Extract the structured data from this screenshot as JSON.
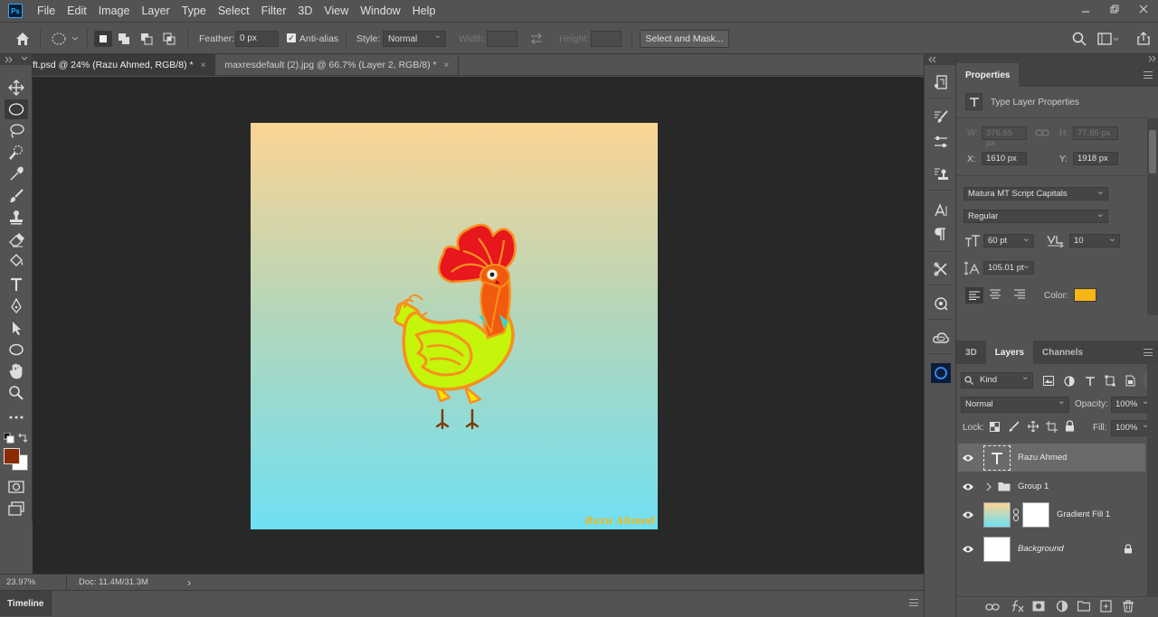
{
  "app": {
    "logo": "Ps",
    "menu": [
      "File",
      "Edit",
      "Image",
      "Layer",
      "Type",
      "Select",
      "Filter",
      "3D",
      "View",
      "Window",
      "Help"
    ]
  },
  "options": {
    "feather_label": "Feather:",
    "feather_value": "0 px",
    "antialias_label": "Anti-alias",
    "style_label": "Style:",
    "style_value": "Normal",
    "width_label": "Width:",
    "height_label": "Height:",
    "select_mask_label": "Select and Mask..."
  },
  "tabs": [
    {
      "label": "ft.psd @ 24% (Razu Ahmed, RGB/8) *",
      "close": "×"
    },
    {
      "label": "maxresdefault (2).jpg @ 66.7% (Layer 2, RGB/8) *",
      "close": "×"
    }
  ],
  "canvas": {
    "signature": "Razu Ahmed",
    "colors": {
      "gradient_top": "#fcd494",
      "gradient_bottom": "#6fe0f2",
      "body": "#c4f50a",
      "outline": "#f7901e",
      "comb": "#e8161d"
    }
  },
  "status": {
    "zoom": "23.97%",
    "doc": "Doc: 11.4M/31.3M",
    "arrow": "›"
  },
  "timeline": {
    "label": "Timeline"
  },
  "properties": {
    "tab": "Properties",
    "title": "Type Layer Properties",
    "w_label": "W:",
    "w_value": "376.55 px",
    "h_label": "H:",
    "h_value": "77.65 px",
    "x_label": "X:",
    "x_value": "1610 px",
    "y_label": "Y:",
    "y_value": "1918 px",
    "font_family": "Matura MT Script Capitals",
    "font_style": "Regular",
    "font_size": "60 pt",
    "tracking": "10",
    "leading": "105.01 pt",
    "color_label": "Color:",
    "text_color": "#f7b516"
  },
  "layers_panel": {
    "tabs": [
      "3D",
      "Layers",
      "Channels"
    ],
    "kind": "Kind",
    "blend": "Normal",
    "opacity_label": "Opacity:",
    "opacity_value": "100%",
    "lock_label": "Lock:",
    "fill_label": "Fill:",
    "fill_value": "100%",
    "layers": [
      {
        "name": "Razu Ahmed",
        "type": "text"
      },
      {
        "name": "Group 1",
        "type": "group"
      },
      {
        "name": "Gradient Fill 1",
        "type": "fill"
      },
      {
        "name": "Background",
        "type": "background"
      }
    ]
  }
}
